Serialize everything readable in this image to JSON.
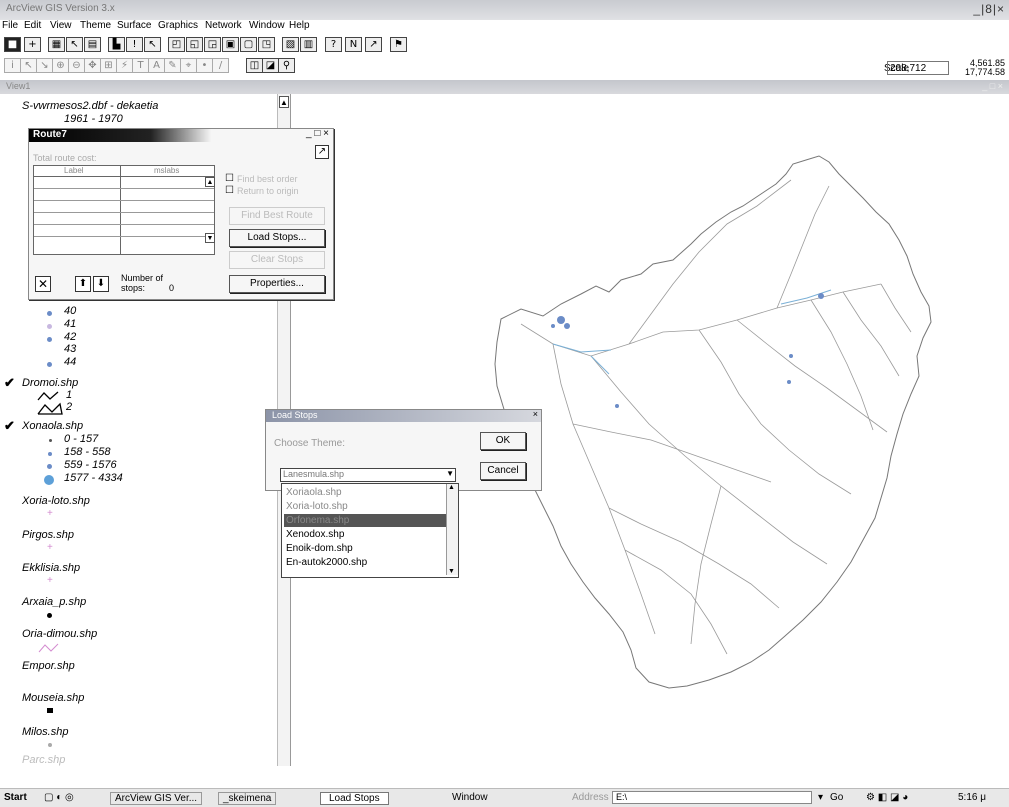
{
  "menu": [
    "File",
    "Edit",
    "View",
    "Theme",
    "Surface",
    "Graphics",
    "Network",
    "Window",
    "Help"
  ],
  "window_buttons": "_|8|×",
  "scale": {
    "label": "Scale",
    "value": "208,712"
  },
  "coords": {
    "x": "4,561.85",
    "y": "17,774.58"
  },
  "toc": {
    "top_item": "S-vwrmesos2.dbf - dekaetia",
    "top_range": "1961 - 1970",
    "legend_numbers": [
      "40",
      "41",
      "42",
      "43",
      "44"
    ],
    "dromoi": {
      "name": "Dromoi.shp",
      "classes": [
        "1",
        "2"
      ]
    },
    "xonaola": {
      "name": "Xonaola.shp",
      "classes": [
        "0 - 157",
        "158 - 558",
        "559 - 1576",
        "1577 - 4334"
      ]
    },
    "themes": [
      "Xoria-loto.shp",
      "Pirgos.shp",
      "Ekklisia.shp",
      "Arxaia_p.shp",
      "Oria-dimou.shp",
      "Empor.shp",
      "Mouseia.shp",
      "Milos.shp",
      "Parc.shp"
    ]
  },
  "route": {
    "title": "Route7",
    "total_cost": "Total route cost:",
    "col_a": "Label",
    "col_b": "mslabs",
    "stops_label": "Number of stops:",
    "stops_value": "0",
    "check1": "Find best order",
    "check2": "Return to origin",
    "buttons": {
      "dis1": "Find Best Route",
      "load": "Load Stops...",
      "dis2": "Clear Stops",
      "props": "Properties..."
    }
  },
  "load_stops": {
    "title": "Load Stops",
    "label": "Choose Theme:",
    "ok": "OK",
    "cancel": "Cancel",
    "selected": "Lanesmula.shp",
    "options": [
      "Xoriaola.shp",
      "Xoria-loto.shp",
      "Orfonema.shp",
      "Xenodox.shp",
      "Enoik-dom.shp",
      "En-autok2000.shp"
    ],
    "highlighted_index": 2
  },
  "taskbar": {
    "start": "Start",
    "arcview": "ArcView GIS Ver...",
    "skeimena": "_skeimena",
    "load_stops": "Load Stops",
    "window": "Window",
    "address_label": "Address",
    "address_value": "E:\\",
    "go": "Go",
    "time": "5:16 μ"
  }
}
